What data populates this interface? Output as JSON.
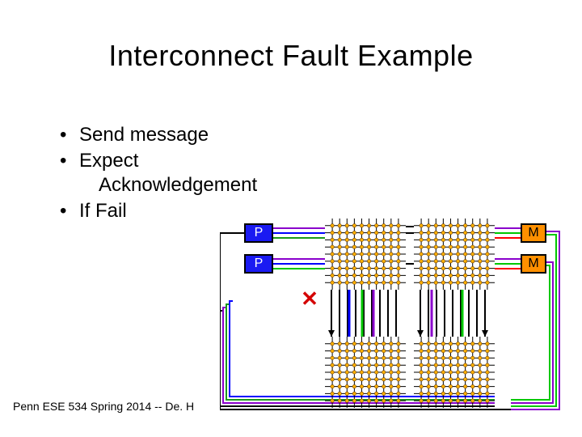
{
  "title": "Interconnect Fault Example",
  "bullets": [
    {
      "text": "Send message"
    },
    {
      "text": "Expect",
      "cont": "Acknowledgement"
    },
    {
      "text": "If Fail"
    }
  ],
  "footer": "Penn ESE 534 Spring 2014 -- De. H",
  "labels": {
    "p": "P",
    "m": "M"
  },
  "fault_mark": "✕",
  "diagram": {
    "processors": 2,
    "memories": 2,
    "crossbars": 4,
    "fault": {
      "between": "grid1-grid3",
      "type": "broken-link"
    },
    "wire_colors": [
      "#000000",
      "#8a00cc",
      "#1a9a1a",
      "#0000ff",
      "#00c800",
      "#ff0000"
    ]
  }
}
